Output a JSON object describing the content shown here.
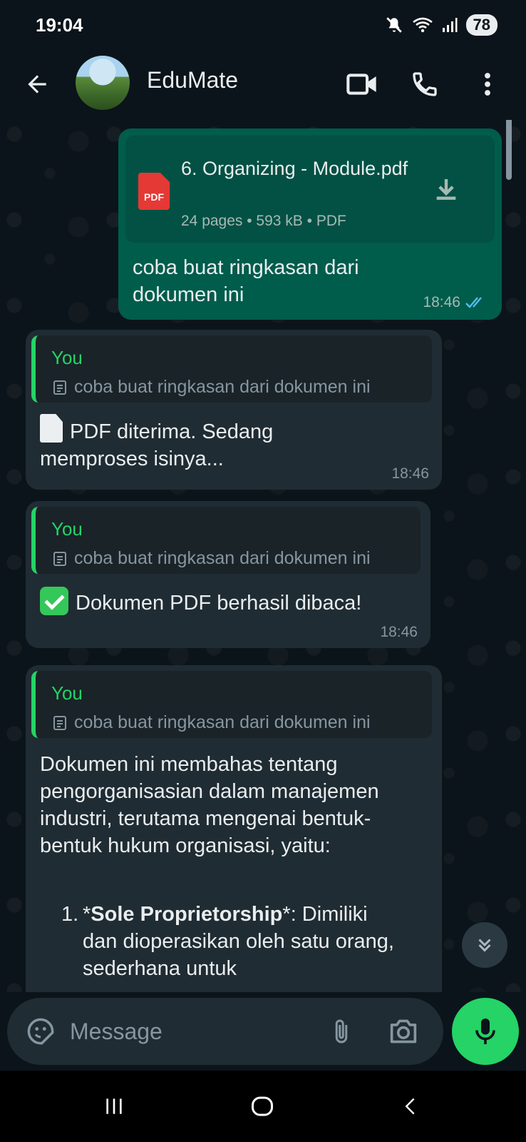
{
  "status_bar": {
    "time": "19:04",
    "battery": "78"
  },
  "header": {
    "contact_name": "EduMate"
  },
  "messages": {
    "outgoing": {
      "doc_name": "6. Organizing - Module.pdf",
      "doc_meta": "24 pages • 593 kB • PDF",
      "doc_icon_label": "PDF",
      "text": "coba buat ringkasan dari dokumen ini",
      "time": "18:46"
    },
    "reply1": {
      "quote_author": "You",
      "quote_text": "coba buat ringkasan dari dokumen ini",
      "text": "PDF diterima. Sedang memproses isinya...",
      "time": "18:46"
    },
    "reply2": {
      "quote_author": "You",
      "quote_text": "coba buat ringkasan dari dokumen ini",
      "text": "Dokumen PDF berhasil dibaca!",
      "time": "18:46"
    },
    "reply3": {
      "quote_author": "You",
      "quote_text": "coba buat ringkasan dari dokumen ini",
      "text": "Dokumen ini membahas tentang pengorganisasian dalam manajemen industri, terutama mengenai bentuk-bentuk hukum organisasi, yaitu:",
      "list": [
        {
          "num": "1.",
          "prefix": "*",
          "bold": "Sole Proprietorship",
          "suffix": "*: Dimiliki dan dioperasikan oleh satu orang, sederhana untuk"
        }
      ]
    }
  },
  "input": {
    "placeholder": "Message"
  },
  "colors": {
    "accent": "#25d366",
    "outgoing_bubble": "#005c4b",
    "incoming_bubble": "#202c33",
    "background": "#0b141a",
    "read_ticks": "#53bdeb"
  }
}
